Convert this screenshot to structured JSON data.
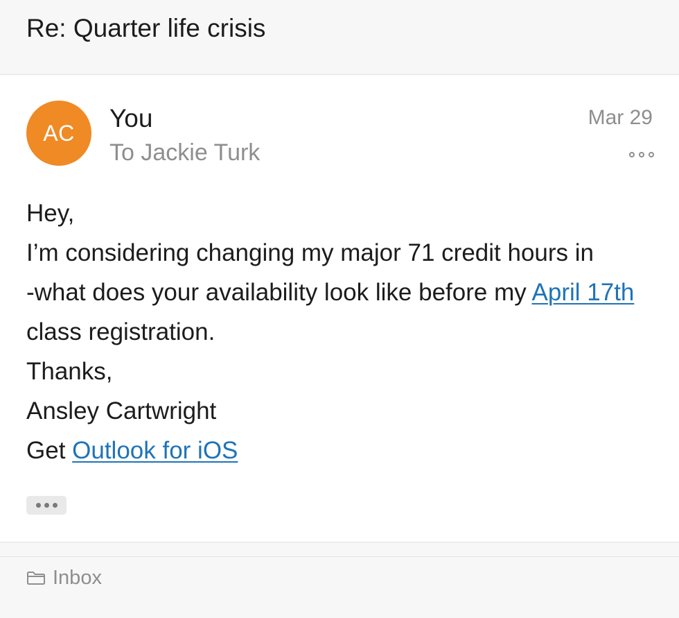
{
  "subject": {
    "title": "Re: Quarter life crisis"
  },
  "message": {
    "avatar_initials": "AC",
    "avatar_color": "#ef8a24",
    "sender": "You",
    "recipient_line": "To Jackie Turk",
    "date": "Mar 29",
    "more_icon": "more-horizontal-icon",
    "body": {
      "greeting": "Hey,",
      "line1": "I’m considering changing my major 71 credit hours in",
      "line2_before_link": "-what does your availability look like before my ",
      "date_link": "April 17th",
      "line2_after_link": " class registration.",
      "signoff": "Thanks,",
      "signature": "Ansley Cartwright",
      "get_prefix": "Get ",
      "outlook_link": "Outlook for iOS"
    },
    "trimmed_content_icon": "ellipsis-icon"
  },
  "footer": {
    "folder_icon": "folder-icon",
    "folder_label": "Inbox"
  },
  "colors": {
    "link": "#1f73b7",
    "secondary_text": "#8e8e8e",
    "header_background": "#f7f7f7"
  }
}
